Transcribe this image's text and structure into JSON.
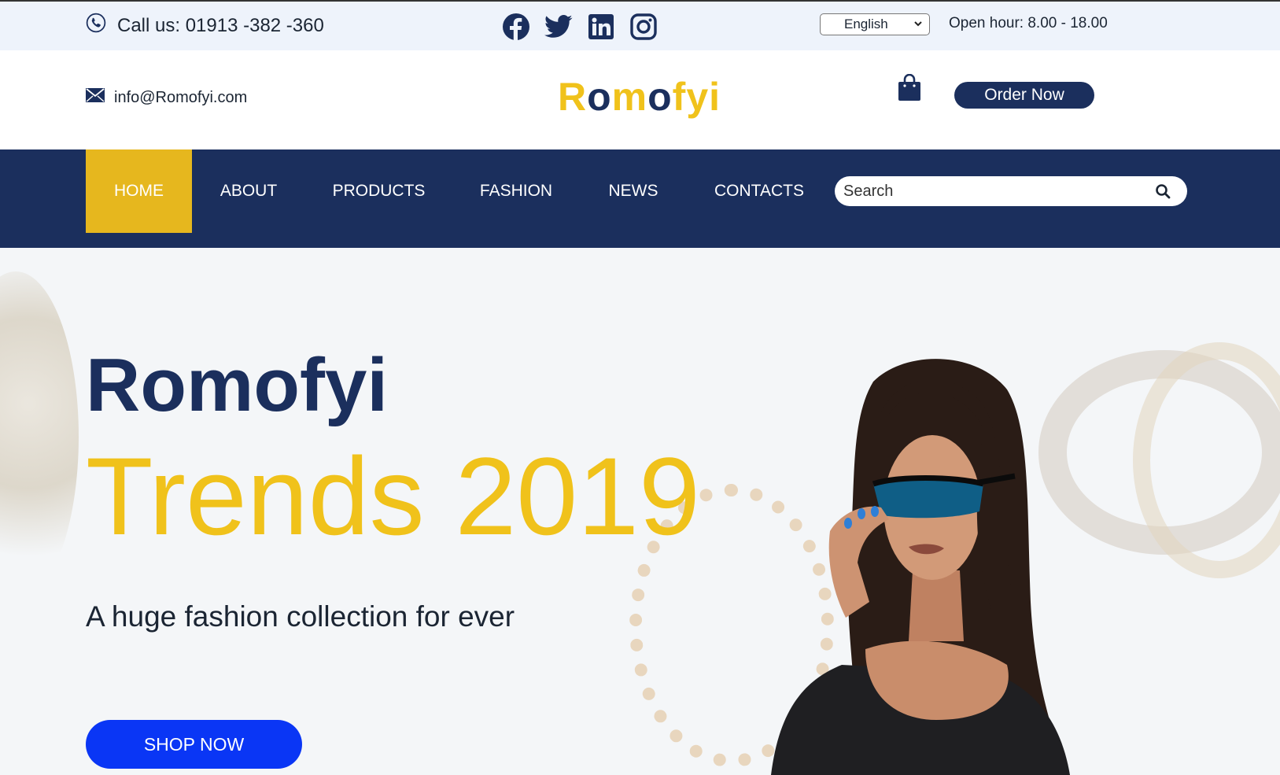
{
  "topbar": {
    "phone_label": "Call us: 01913 -382 -360",
    "social": [
      {
        "icon": "facebook-icon"
      },
      {
        "icon": "twitter-icon"
      },
      {
        "icon": "linkedin-icon"
      },
      {
        "icon": "instagram-icon"
      }
    ],
    "language": "English",
    "hours": "Open hour: 8.00 - 18.00"
  },
  "header": {
    "email": "info@Romofyi.com",
    "logo": {
      "part1": "R",
      "part2": "o",
      "part3": "m",
      "part4": "o",
      "part5": "fyi"
    },
    "order_label": "Order Now"
  },
  "nav": {
    "items": [
      "HOME",
      "ABOUT",
      "PRODUCTS",
      "FASHION",
      "NEWS",
      "CONTACTS"
    ],
    "active": "HOME",
    "search_placeholder": "Search"
  },
  "hero": {
    "title": "Romofyi",
    "subtitle": "Trends 2019",
    "tagline": "A huge fashion collection for ever",
    "cta": "SHOP NOW"
  },
  "colors": {
    "navy": "#1b2f5d",
    "yellow": "#f0c21b",
    "active_tab": "#e6b71e",
    "cta_blue": "#0a36f5"
  }
}
